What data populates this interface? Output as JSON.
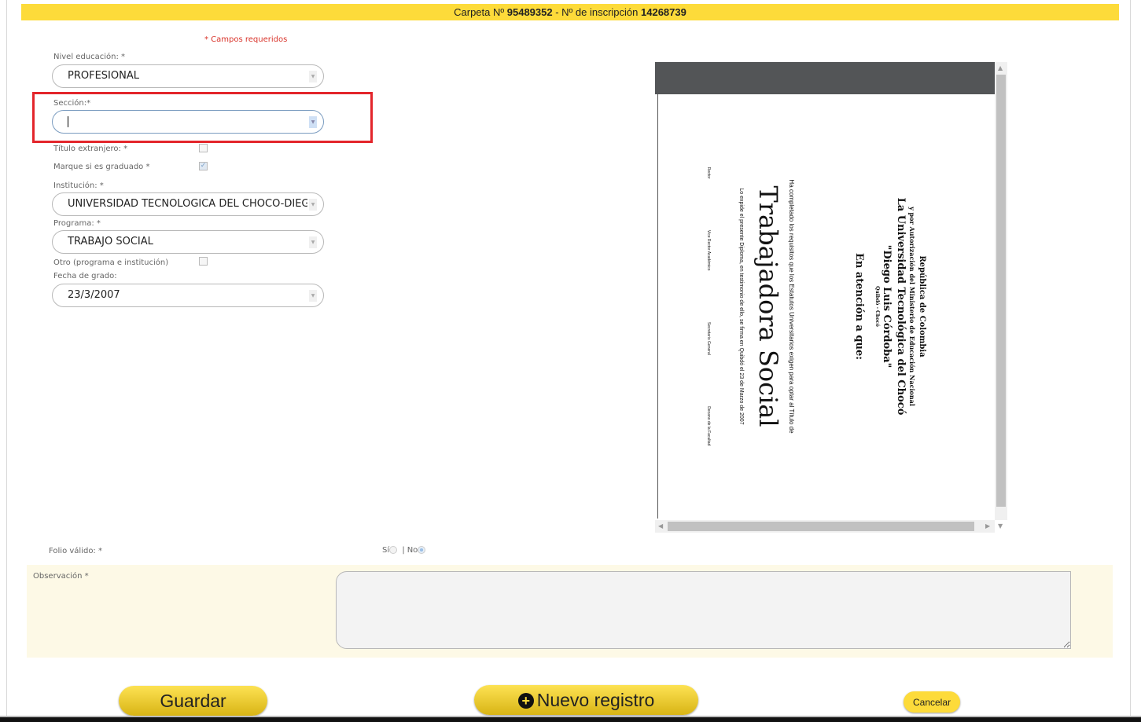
{
  "header": {
    "carpeta_label": "Carpeta Nº",
    "carpeta": "95489352",
    "sep": " - ",
    "inscripcion_label": "Nº de inscripción",
    "inscripcion": "14268739",
    "color": "#fddb3a"
  },
  "form": {
    "required_note": "* Campos requeridos",
    "nivel_label": "Nivel educación: *",
    "nivel_value": "PROFESIONAL",
    "seccion_label": "Sección:*",
    "seccion_value": "",
    "titulo_ext_label": "Título extranjero: *",
    "titulo_ext_checked": false,
    "graduado_label": "Marque si es graduado *",
    "graduado_checked": true,
    "institucion_label": "Institución: *",
    "institucion_value": "UNIVERSIDAD TECNOLOGICA DEL CHOCO-DIEGO LUIS CORDOBA",
    "programa_label": "Programa: *",
    "programa_value": "TRABAJO SOCIAL",
    "otro_label": "Otro (programa e institución)",
    "otro_checked": false,
    "fecha_label": "Fecha de grado:",
    "fecha_value": "23/3/2007",
    "folio_label": "Folio válido: *",
    "si_label": "Sí",
    "sep": "|",
    "no_label": "No",
    "folio_value": "No",
    "observacion_label": "Observación *",
    "observacion_value": ""
  },
  "document": {
    "line1": "República de Colombia",
    "line2": "y por Autorización del Ministerio de Educación Nacional",
    "line3": "La Universidad Tecnológica del Chocó",
    "line4": "\"Diego Luis Córdoba\"",
    "line5": "Quibdó - Chocó",
    "line6": "En atención a que:",
    "line7": "Ha completado los requisitos que los Estatutos Universitarios exigen para optar al Título de",
    "title": "Trabajadora Social",
    "line8": "Lo expide el presente Diploma, en testimonio de ello, se firma en Quibdó el 23 de Marzo de 2007",
    "signers": [
      "Rector",
      "Vice Rector Académico",
      "Secretario General",
      "Decano de la Facultad"
    ]
  },
  "buttons": {
    "save": "Guardar",
    "new": "Nuevo registro",
    "cancel": "Cancelar",
    "accent": "#e9c524"
  }
}
